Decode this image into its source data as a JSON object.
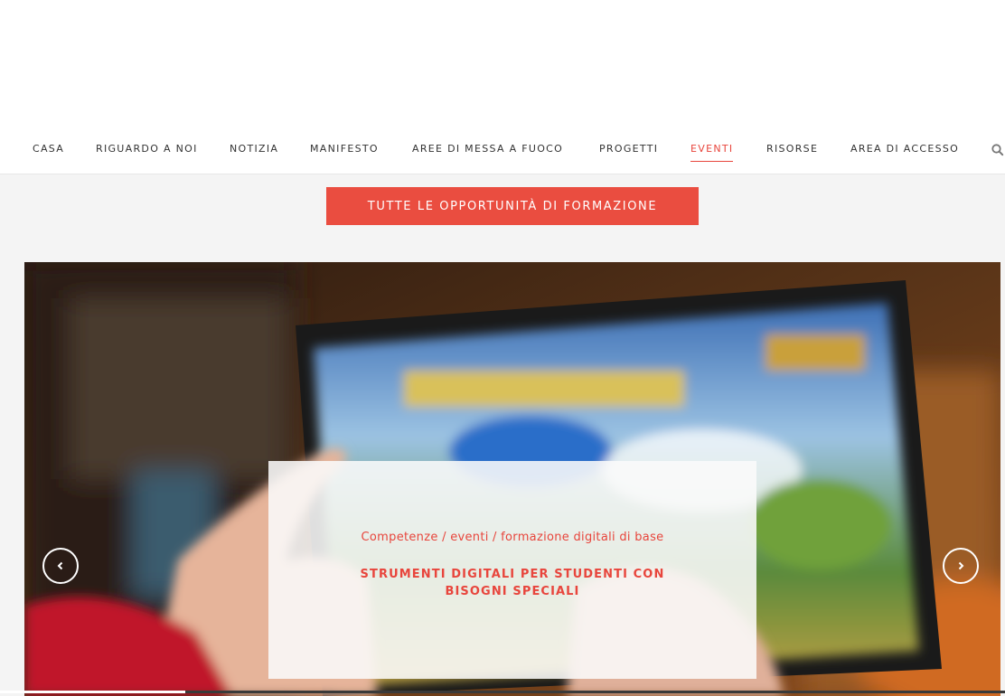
{
  "header": {
    "nav": [
      {
        "label": "CASA",
        "active": false
      },
      {
        "label": "RIGUARDO A NOI",
        "active": false
      },
      {
        "label": "NOTIZIA",
        "active": false
      },
      {
        "label": "MANIFESTO",
        "active": false
      },
      {
        "label": "AREE DI MESSA A FUOCO",
        "active": false
      },
      {
        "label": "PROGETTI",
        "active": false
      },
      {
        "label": "EVENTI",
        "active": true
      },
      {
        "label": "RISORSE",
        "active": false
      },
      {
        "label": "AREA DI ACCESSO",
        "active": false
      }
    ],
    "search_icon": "search-icon"
  },
  "cta": {
    "label": "TUTTE LE OPPORTUNITÀ DI FORMAZIONE"
  },
  "slider": {
    "prev_icon": "chevron-left-icon",
    "next_icon": "chevron-right-icon",
    "slide": {
      "category": "Competenze / eventi / formazione digitali di base",
      "title": "STRUMENTI DIGITALI PER STUDENTI CON BISOGNI SPECIALI"
    }
  },
  "colors": {
    "accent": "#e8453c",
    "button": "#ea4d40",
    "nav_text": "#333333",
    "page_bg": "#f4f4f4"
  }
}
